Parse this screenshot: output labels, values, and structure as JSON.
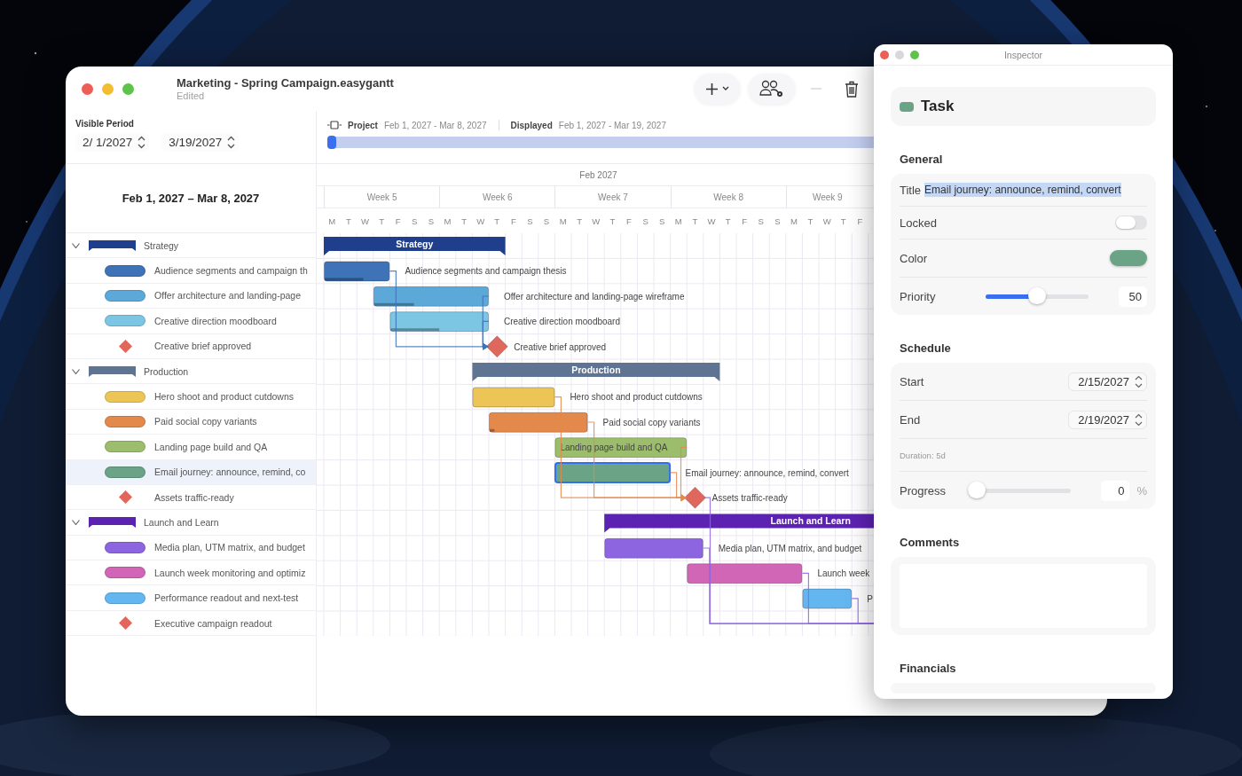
{
  "window": {
    "title": "Marketing - Spring Campaign.easygantt",
    "subtitle": "Edited"
  },
  "toolbar": [
    {
      "kind": "add",
      "disabled": false
    },
    {
      "kind": "people",
      "disabled": false
    },
    {
      "kind": "remove",
      "disabled": true
    },
    {
      "kind": "delete",
      "disabled": false
    }
  ],
  "visible_period": {
    "label": "Visible Period",
    "start": "2/ 1/2027",
    "end": "3/19/2027"
  },
  "project_bar": {
    "project_label": "Project",
    "project_range": "Feb 1, 2027 - Mar 8, 2027",
    "displayed_label": "Displayed",
    "displayed_range": "Feb 1, 2027 - Mar 19, 2027"
  },
  "timeline": {
    "month": "Feb 2027",
    "weeks": [
      "Week 5",
      "Week 6",
      "Week 7",
      "Week 8",
      "Week 9"
    ],
    "days": [
      "M",
      "T",
      "W",
      "T",
      "F",
      "S",
      "S",
      "M",
      "T",
      "W",
      "T",
      "F",
      "S",
      "S",
      "M",
      "T",
      "W",
      "T",
      "F",
      "S",
      "S",
      "M",
      "T",
      "W",
      "T",
      "F",
      "S",
      "S",
      "M",
      "T",
      "W",
      "T",
      "F"
    ]
  },
  "task_list": {
    "heading": "Feb 1, 2027 – Mar 8, 2027",
    "groups": [
      {
        "name": "Strategy",
        "bar_label": "Strategy",
        "color": "#1f3f8c",
        "expanded": true,
        "selected": false,
        "tasks": [
          {
            "kind": "task",
            "name": "Audience segments and campaign th",
            "bar_label": "Audience segments and campaign thesis",
            "color": "#3f73b8",
            "level": 0.6,
            "selected": false
          },
          {
            "kind": "task",
            "name": "Offer architecture and landing-page",
            "bar_label": "Offer architecture and landing-page wireframe",
            "color": "#5ca9d9",
            "level": 0.35,
            "selected": false
          },
          {
            "kind": "task",
            "name": "Creative direction moodboard",
            "bar_label": "Creative direction moodboard",
            "color": "#7cc5e3",
            "level": 0.5,
            "selected": false
          },
          {
            "kind": "milestone",
            "name": "Creative brief approved",
            "bar_label": "Creative brief approved",
            "color": "#e0675c",
            "selected": false
          }
        ]
      },
      {
        "name": "Production",
        "bar_label": "Production",
        "color": "#5f7392",
        "expanded": true,
        "selected": false,
        "tasks": [
          {
            "kind": "task",
            "name": "Hero shoot and product cutdowns",
            "bar_label": "Hero shoot and product cutdowns",
            "color": "#ecc556",
            "selected": false
          },
          {
            "kind": "task",
            "name": "Paid social copy variants",
            "bar_label": "Paid social copy variants",
            "color": "#e4894c",
            "level": 0.05,
            "selected": false
          },
          {
            "kind": "task",
            "name": "Landing page build and QA",
            "bar_label": "Landing page build and QA",
            "color": "#9cbe6c",
            "selected": false
          },
          {
            "kind": "task",
            "name": "Email journey: announce, remind, co",
            "bar_label": "Email journey: announce, remind, convert",
            "color": "#6aa386",
            "selected": true
          },
          {
            "kind": "milestone",
            "name": "Assets traffic-ready",
            "bar_label": "Assets traffic-ready",
            "color": "#e0675c",
            "selected": false
          }
        ]
      },
      {
        "name": "Launch and Learn",
        "bar_label": "Launch and Learn",
        "color": "#5c22b2",
        "expanded": true,
        "selected": false,
        "tasks": [
          {
            "kind": "task",
            "name": "Media plan, UTM matrix, and budget",
            "bar_label": "Media plan, UTM matrix, and budget",
            "color": "#8e65e1",
            "selected": false
          },
          {
            "kind": "task",
            "name": "Launch week monitoring and optimiz",
            "bar_label": "Launch week",
            "color": "#d266b6",
            "selected": false
          },
          {
            "kind": "task",
            "name": "Performance readout and next-test",
            "bar_label": "P",
            "color": "#64b6f1",
            "selected": false
          },
          {
            "kind": "milestone",
            "name": "Executive campaign readout",
            "color": "#e0675c",
            "selected": false
          }
        ]
      }
    ]
  },
  "inspector": {
    "title": "Inspector",
    "header": {
      "title": "Task",
      "color": "#6aa386"
    },
    "sections": [
      {
        "heading": "General",
        "fields": [
          {
            "kind": "text",
            "label": "Title",
            "value": "Email journey: announce, remind, convert",
            "selected": true
          },
          {
            "kind": "toggle",
            "label": "Locked",
            "on": false
          },
          {
            "kind": "color",
            "label": "Color",
            "color": "#6aa386"
          },
          {
            "kind": "slider",
            "label": "Priority",
            "level": 0.5,
            "value": "50"
          }
        ]
      },
      {
        "heading": "Schedule",
        "fields": [
          {
            "kind": "date",
            "label": "Start",
            "value": "2/15/2027"
          },
          {
            "kind": "date",
            "label": "End",
            "value": "2/19/2027"
          },
          {
            "kind": "note",
            "label": "Duration: 5d"
          },
          {
            "kind": "slider",
            "label": "Progress",
            "level": 0,
            "value": "0",
            "unit": "%"
          }
        ]
      },
      {
        "heading": "Comments",
        "fields": [
          {
            "kind": "textarea"
          }
        ]
      },
      {
        "heading": "Financials"
      }
    ]
  }
}
